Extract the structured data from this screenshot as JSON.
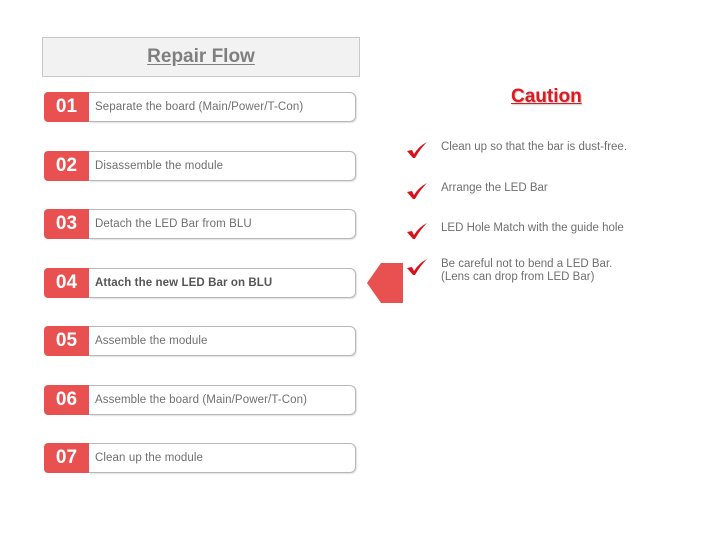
{
  "header": {
    "title": "Repair Flow"
  },
  "steps": [
    {
      "number": "01",
      "label": "Separate the board (Main/Power/T-Con)",
      "active": false
    },
    {
      "number": "02",
      "label": "Disassemble the module",
      "active": false
    },
    {
      "number": "03",
      "label": "Detach the LED Bar from BLU",
      "active": false
    },
    {
      "number": "04",
      "label": "Attach the new LED Bar on BLU",
      "active": true
    },
    {
      "number": "05",
      "label": "Assemble the module",
      "active": false
    },
    {
      "number": "06",
      "label": "Assemble the board (Main/Power/T-Con)",
      "active": false
    },
    {
      "number": "07",
      "label": "Clean up the module",
      "active": false
    }
  ],
  "caution": {
    "title": "Caution",
    "items": [
      {
        "icon": "checkmark-icon",
        "line1": "Clean up so that the bar is dust-free.",
        "line2": ""
      },
      {
        "icon": "checkmark-icon",
        "line1": "Arrange the LED Bar",
        "line2": ""
      },
      {
        "icon": "checkmark-icon",
        "line1": "LED Hole Match with the guide hole",
        "line2": ""
      },
      {
        "icon": "checkmark-icon",
        "line1": "Be careful not to bend a LED Bar.",
        "line2": "(Lens can drop from LED Bar)"
      }
    ]
  },
  "colors": {
    "accent": "#e8514f",
    "caution": "#e0181f",
    "text": "#6f6f6f"
  }
}
